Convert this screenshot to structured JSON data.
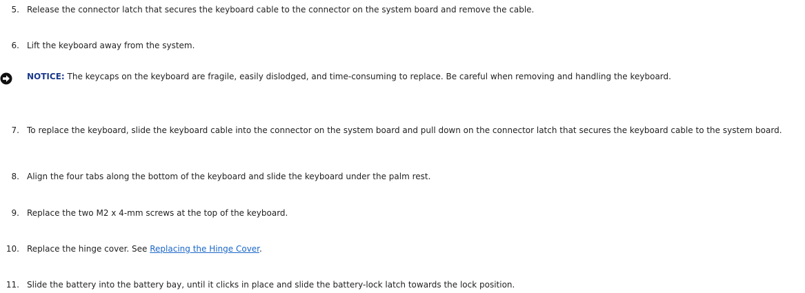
{
  "steps": [
    {
      "num": "5.",
      "text": "Release the connector latch that secures the keyboard cable to the connector on the system board and remove the cable."
    },
    {
      "num": "6.",
      "text": "Lift the keyboard away from the system."
    },
    {
      "num": "7.",
      "text": "To replace the keyboard, slide the keyboard cable into the connector on the system board and pull down on the connector latch that secures the keyboard cable to the system board."
    },
    {
      "num": "8.",
      "text": "Align the four tabs along the bottom of the keyboard and slide the keyboard under the palm rest."
    },
    {
      "num": "9.",
      "text": "Replace the two M2 x 4-mm screws at the top of the keyboard."
    },
    {
      "num": "10.",
      "text_before": "Replace the hinge cover. See ",
      "link": "Replacing the Hinge Cover",
      "text_after": "."
    },
    {
      "num": "11.",
      "text": "Slide the battery into the battery bay, until it clicks in place and slide the battery-lock latch towards the lock position."
    }
  ],
  "notice": {
    "label": "NOTICE:",
    "text": " The keycaps on the keyboard are fragile, easily dislodged, and time-consuming to replace. Be careful when removing and handling the keyboard.",
    "icon": "notice-arrow-icon"
  }
}
